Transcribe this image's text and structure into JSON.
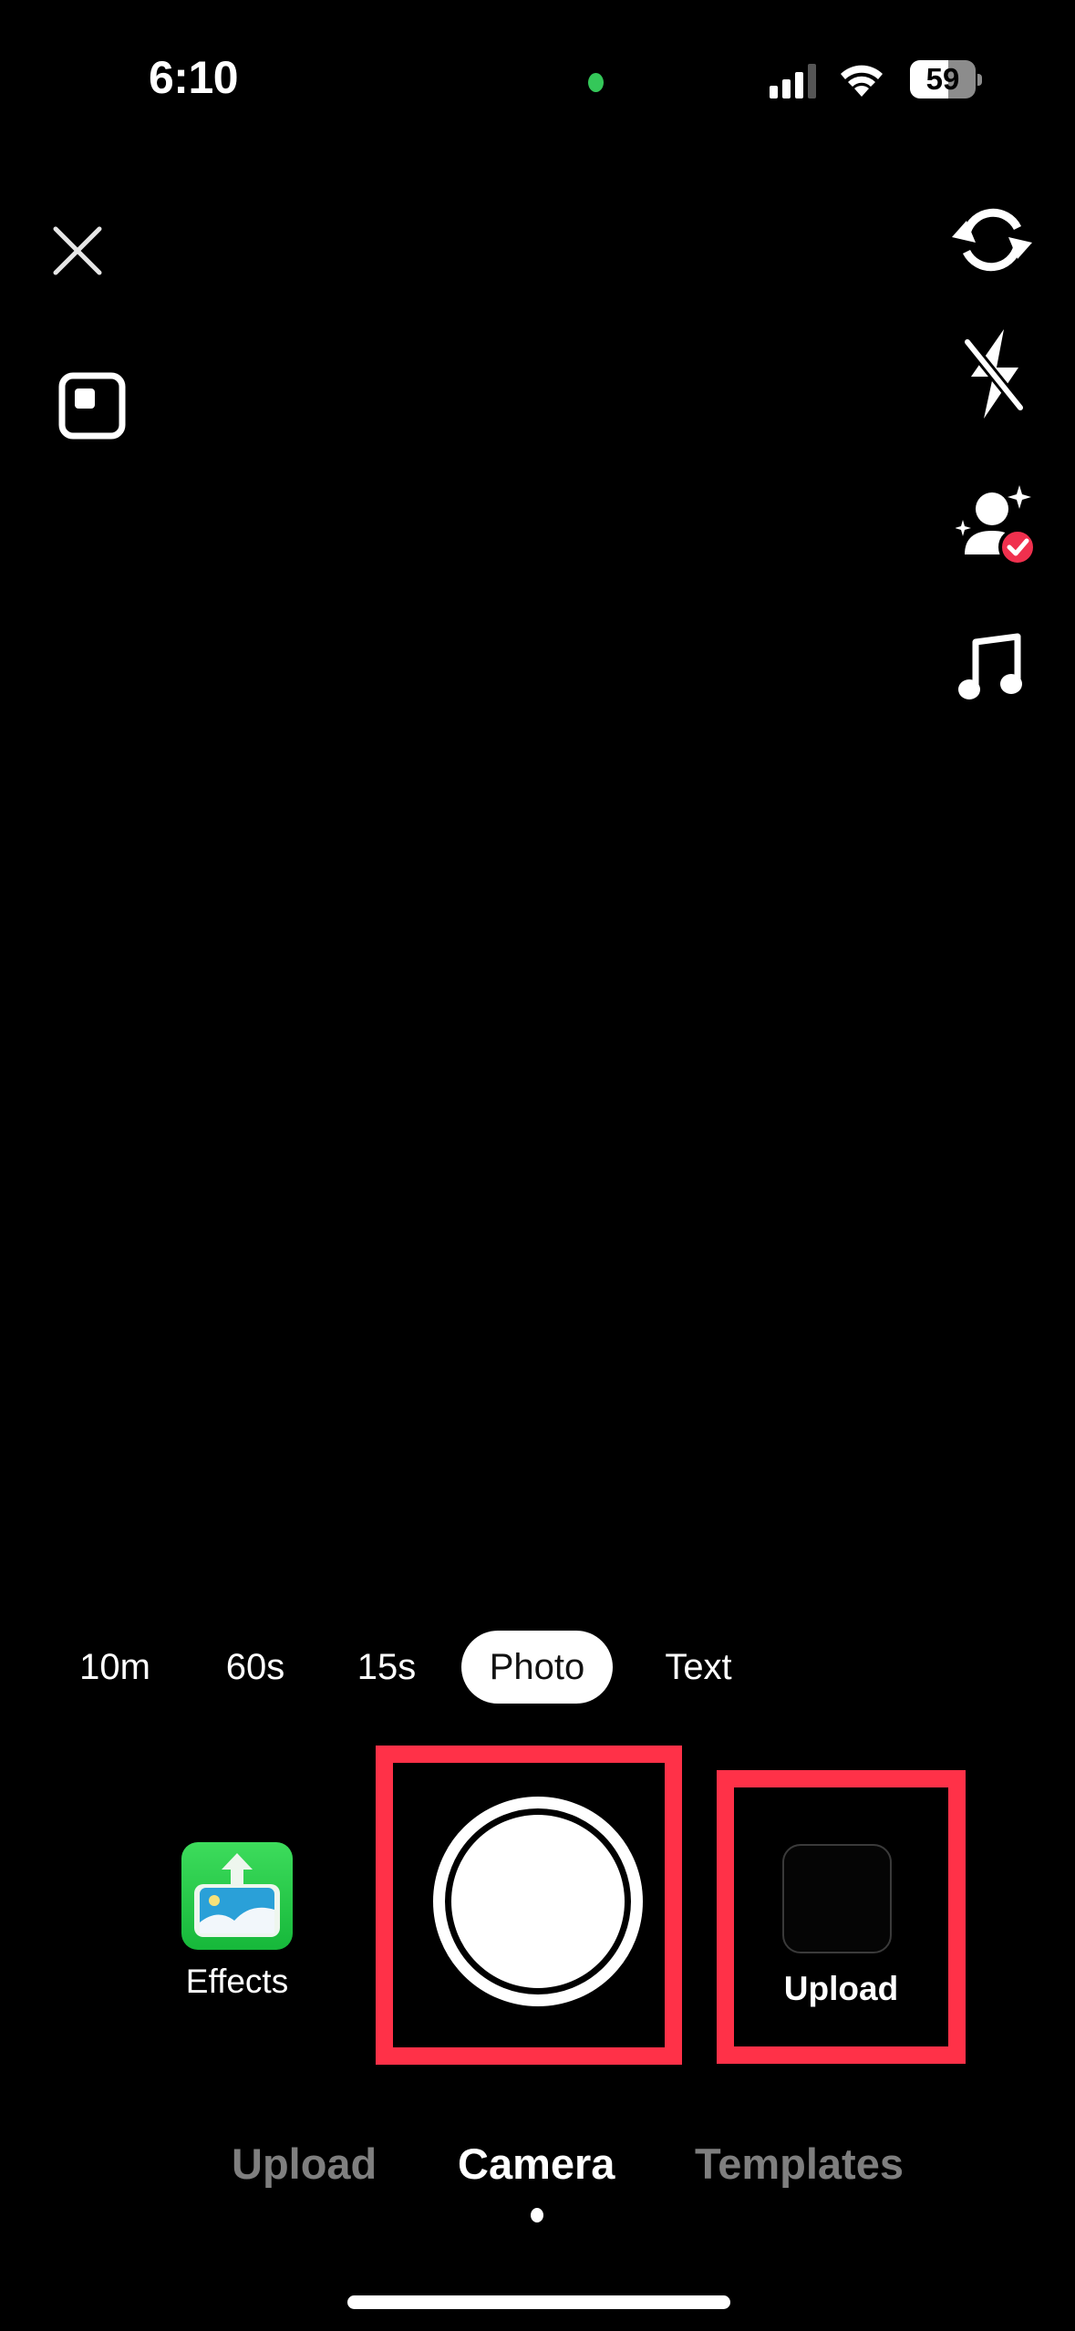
{
  "status_bar": {
    "time": "6:10",
    "battery_level": 59,
    "battery_text": "59",
    "mic_indicator_color": "#34c759"
  },
  "top_left": {
    "icons": [
      "close-icon",
      "aspect-ratio-icon"
    ]
  },
  "right_toolbar": {
    "icons": [
      "flip-camera-icon",
      "flash-off-icon",
      "beauty-icon",
      "music-icon"
    ],
    "beauty_badge_color": "#f0304e"
  },
  "modes": {
    "items": [
      {
        "label": "10m",
        "active": false
      },
      {
        "label": "60s",
        "active": false
      },
      {
        "label": "15s",
        "active": false
      },
      {
        "label": "Photo",
        "active": true
      },
      {
        "label": "Text",
        "active": false
      }
    ]
  },
  "capture_row": {
    "effects_label": "Effects",
    "upload_label": "Upload",
    "highlight_color": "#ff3148"
  },
  "bottom_tabs": {
    "items": [
      {
        "label": "Upload",
        "active": false
      },
      {
        "label": "Camera",
        "active": true
      },
      {
        "label": "Templates",
        "active": false
      }
    ]
  }
}
